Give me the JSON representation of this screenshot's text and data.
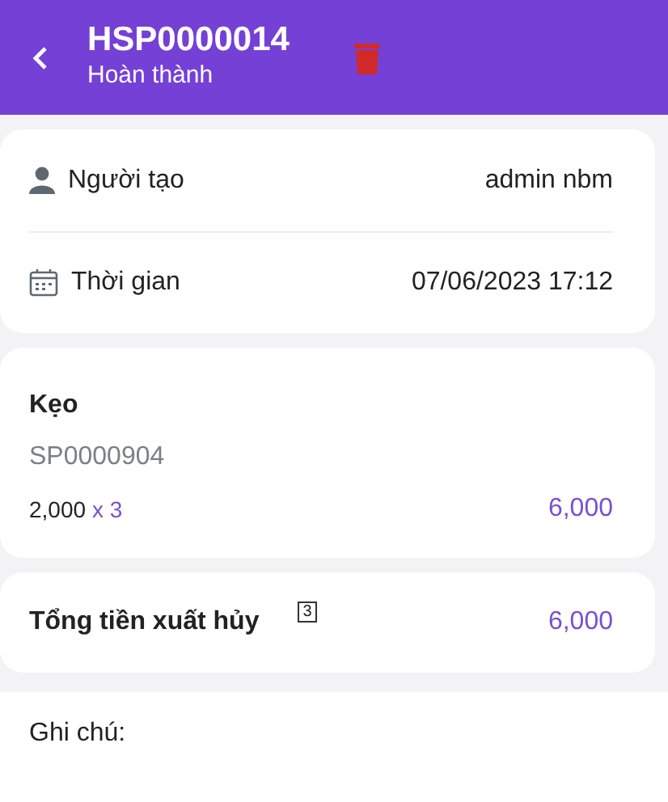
{
  "header": {
    "title": "HSP0000014",
    "status": "Hoàn thành"
  },
  "info": [
    {
      "kind": "user",
      "label": "Người tạo",
      "value": "admin nbm"
    },
    {
      "kind": "calendar",
      "label": "Thời gian",
      "value": "07/06/2023 17:12"
    }
  ],
  "items": [
    {
      "name": "Kẹo",
      "code": "SP0000904",
      "price": "2,000",
      "quantity": "x 3",
      "total": "6,000"
    }
  ],
  "summary": {
    "label": "Tổng tiền xuất hủy",
    "marker": "3",
    "value": "6,000"
  },
  "note": {
    "label": "Ghi chú:"
  }
}
